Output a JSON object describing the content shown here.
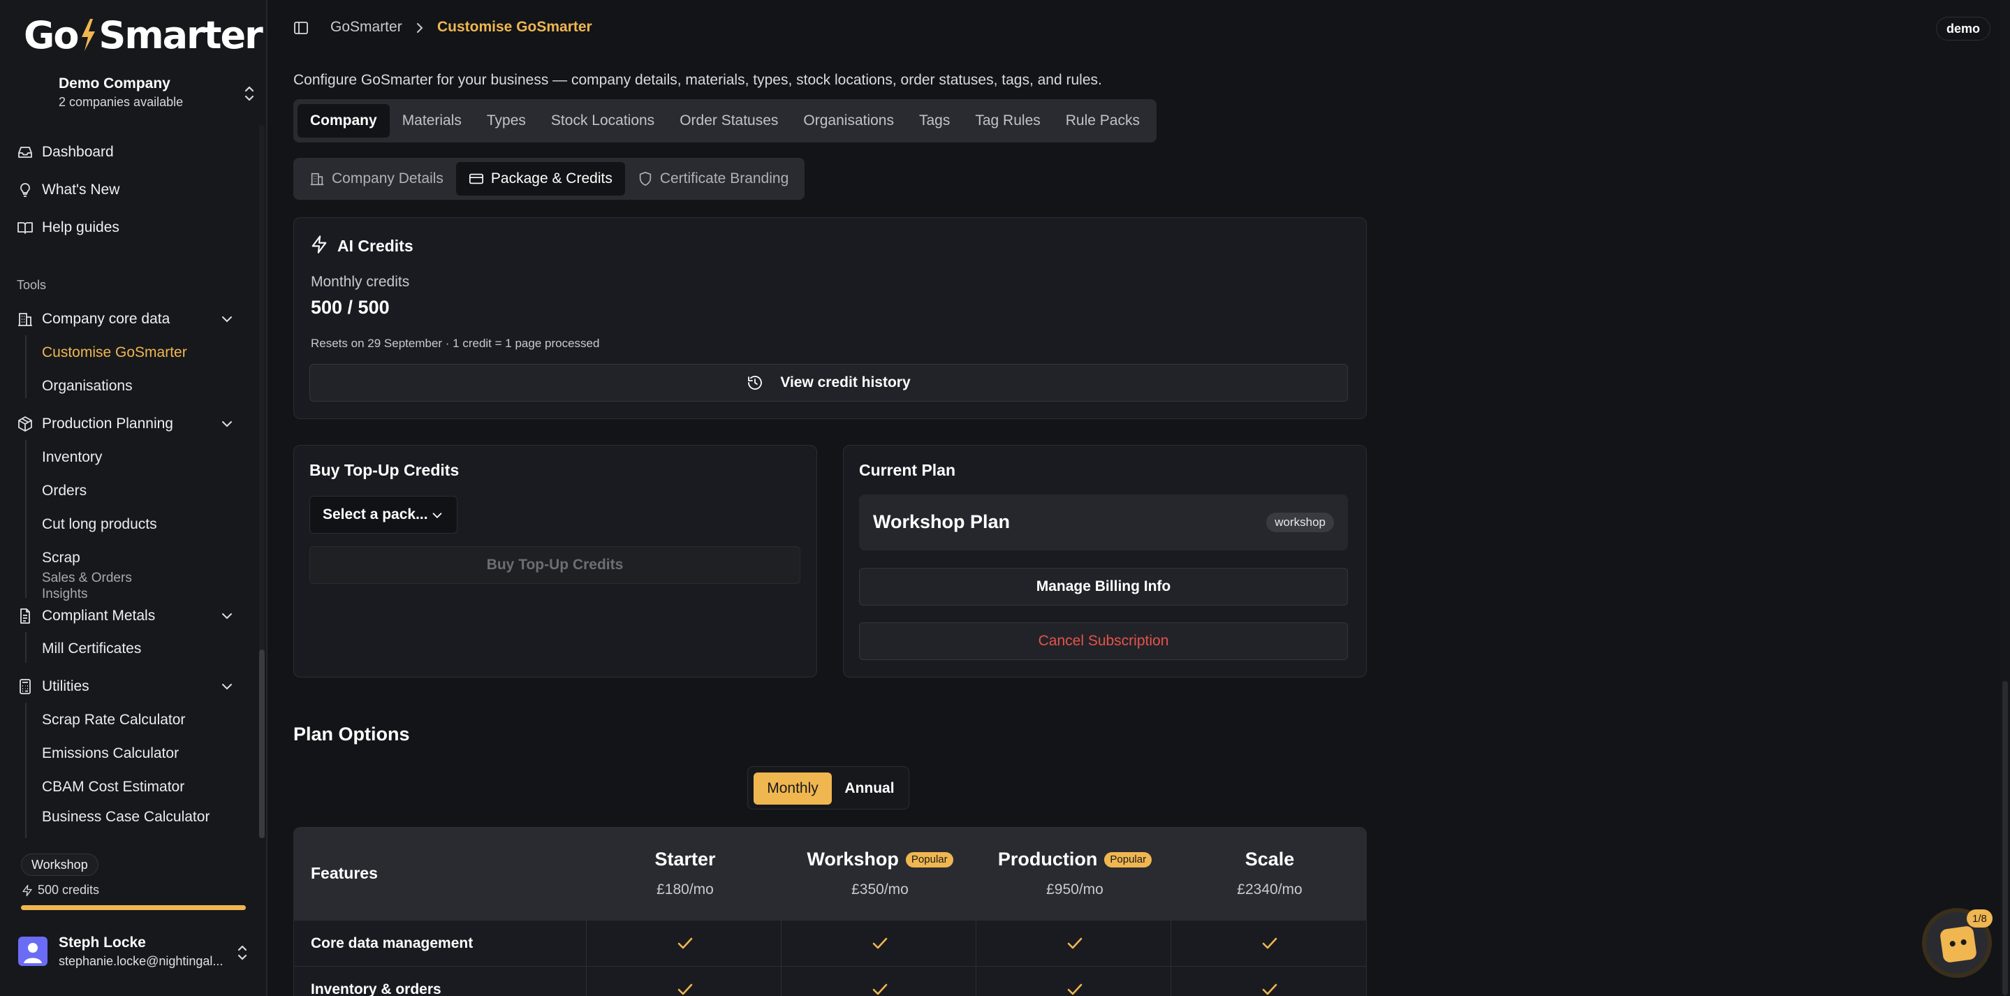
{
  "app": {
    "logo_text": "GoSmarter"
  },
  "company": {
    "name": "Demo Company",
    "sub": "2 companies available"
  },
  "nav": {
    "dashboard": "Dashboard",
    "whats_new": "What's New",
    "help": "Help guides",
    "tools_label": "Tools",
    "company_core": "Company core data",
    "customise": "Customise GoSmarter",
    "organisations": "Organisations",
    "production": "Production Planning",
    "inventory": "Inventory",
    "orders": "Orders",
    "cut_long": "Cut long products",
    "scrap": "Scrap",
    "sales_orders": "Sales & Orders",
    "insights": "Insights",
    "compliant": "Compliant Metals",
    "mill_certs": "Mill Certificates",
    "utilities": "Utilities",
    "scrap_rate": "Scrap Rate Calculator",
    "emissions": "Emissions Calculator",
    "cbam": "CBAM Cost Estimator",
    "business_case": "Business Case Calculator"
  },
  "sidebar_footer": {
    "plan": "Workshop",
    "credits": "500 credits",
    "credits_fraction": 1.0
  },
  "user": {
    "name": "Steph Locke",
    "email": "stephanie.locke@nightingal..."
  },
  "breadcrumb": {
    "root": "GoSmarter",
    "current": "Customise GoSmarter"
  },
  "env_badge": "demo",
  "page": {
    "description": "Configure GoSmarter for your business — company details, materials, types, stock locations, order statuses, tags, and rules."
  },
  "tabs": [
    "Company",
    "Materials",
    "Types",
    "Stock Locations",
    "Order Statuses",
    "Organisations",
    "Tags",
    "Tag Rules",
    "Rule Packs"
  ],
  "subtabs": [
    "Company Details",
    "Package & Credits",
    "Certificate Branding"
  ],
  "ai_credits": {
    "title": "AI Credits",
    "monthly_label": "Monthly credits",
    "value": "500 / 500",
    "reset_note": "Resets on 29 September · 1 credit = 1 page processed",
    "history_button": "View credit history"
  },
  "topup": {
    "title": "Buy Top-Up Credits",
    "select_placeholder": "Select a pack...",
    "buy_button": "Buy Top-Up Credits"
  },
  "current_plan": {
    "title": "Current Plan",
    "plan_name": "Workshop Plan",
    "plan_badge": "workshop",
    "manage_button": "Manage Billing Info",
    "cancel_button": "Cancel Subscription"
  },
  "plan_options": {
    "title": "Plan Options",
    "toggle": {
      "monthly": "Monthly",
      "annual": "Annual",
      "selected": "Monthly"
    },
    "features_header": "Features",
    "popular_label": "Popular",
    "plans": [
      {
        "name": "Starter",
        "price": "£180/mo",
        "popular": false
      },
      {
        "name": "Workshop",
        "price": "£350/mo",
        "popular": true
      },
      {
        "name": "Production",
        "price": "£950/mo",
        "popular": true
      },
      {
        "name": "Scale",
        "price": "£2340/mo",
        "popular": false
      }
    ],
    "features": [
      {
        "label": "Core data management",
        "included": [
          true,
          true,
          true,
          true
        ]
      },
      {
        "label": "Inventory & orders",
        "included": [
          true,
          true,
          true,
          true
        ]
      }
    ]
  },
  "helper": {
    "count": "1/8"
  },
  "colors": {
    "accent": "#f0b650",
    "danger": "#e5534b",
    "bg": "#131418"
  }
}
